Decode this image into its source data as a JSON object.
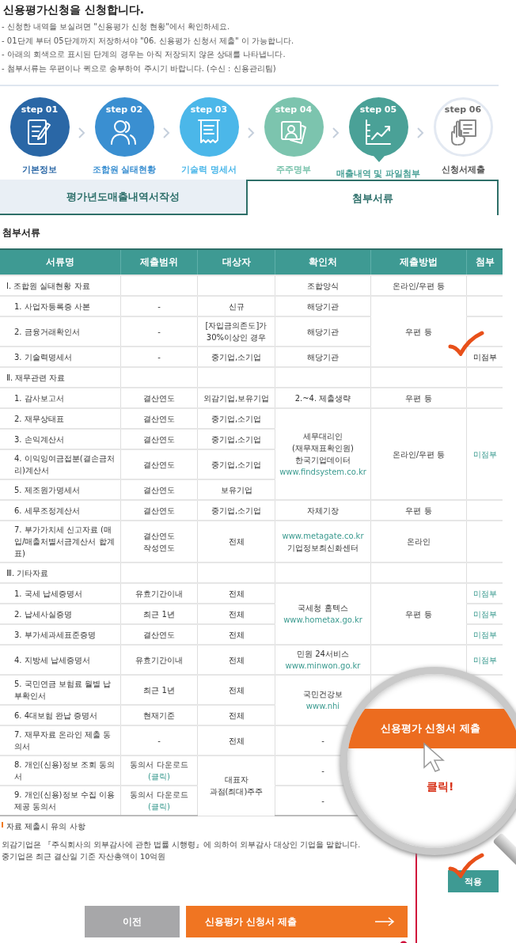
{
  "title": "신용평가신청을 신청합니다.",
  "notices": [
    "- 신청한 내역을 보실려면 \"신용평가 신청 현황\"에서 확인하세요.",
    "- 01단계 부터 05단계까지 저장하셔야 \"06. 신용평가 신청서 제출\" 이 가능합니다.",
    "- 아래의 회색으로 표시된 단계의 경우는 아직 저장되지 않은 상태를 나타냅니다.",
    "- 첨부서류는 우편이나 퀵으로 송부하여 주시기 바랍니다. (수신 : 신용관리팀)"
  ],
  "steps": [
    {
      "number": "step 01",
      "label": "기본정보",
      "color": "#2a67a6",
      "completed": true,
      "selected": false
    },
    {
      "number": "step 02",
      "label": "조합원 실태현황",
      "color": "#3a8fd1",
      "completed": true,
      "selected": false
    },
    {
      "number": "step 03",
      "label": "기술력 명세서",
      "color": "#4bb7e9",
      "completed": true,
      "selected": false
    },
    {
      "number": "step 04",
      "label": "주주명부",
      "color": "#7cc4ae",
      "completed": true,
      "selected": false
    },
    {
      "number": "step 05",
      "label": "매출내역 및 파일첨부",
      "color": "#4aa197",
      "completed": true,
      "selected": true
    },
    {
      "number": "step 06",
      "label": "신청서제출",
      "color": "#ffffff",
      "completed": false,
      "selected": false
    }
  ],
  "tabs": [
    {
      "label": "평가년도매출내역서작성",
      "selected": false
    },
    {
      "label": "첨부서류",
      "selected": true
    }
  ],
  "section_title": "첨부서류",
  "table": {
    "columns": [
      "서류명",
      "제출범위",
      "대상자",
      "확인처",
      "제출방법",
      "첨부"
    ],
    "rows": [
      {
        "kind": "section",
        "cells": [
          "Ⅰ. 조합원 실태현황 자료",
          null,
          null,
          "조합양식",
          "온라인/우편 등",
          null
        ]
      },
      {
        "kind": "item",
        "cells": [
          "1. 사업자등록증 사본",
          "-",
          "신규",
          "해당기관",
          {
            "lines": [
              "우편 등"
            ],
            "rowspan": 3
          },
          null
        ]
      },
      {
        "kind": "item",
        "cells": [
          "2. 금융거래확인서",
          "-",
          {
            "lines": [
              "[자입금의존도]가",
              "30%이상인 경우"
            ]
          },
          "해당기관",
          null
        ]
      },
      {
        "kind": "item",
        "cells": [
          "3. 기술력명세서",
          "-",
          "중기업,소기업",
          "해당기관",
          "미점부"
        ]
      },
      {
        "kind": "section",
        "cells": [
          "Ⅱ. 재무관련 자료",
          null,
          null,
          null,
          null,
          null
        ]
      },
      {
        "kind": "item",
        "cells": [
          "1. 감사보고서",
          "결산연도",
          "외감기업,보유기업",
          "2.~4. 제출생략",
          "우편 등",
          null
        ]
      },
      {
        "kind": "item",
        "cells": [
          "2. 재무상태표",
          "결산연도",
          "중기업,소기업",
          {
            "lines": [
              "세무대리인",
              "(재무재표확인원)",
              "한국기업데이터",
              {
                "text": "www.findsystem.co.kr",
                "kind": "link"
              }
            ],
            "rowspan": 4
          },
          {
            "lines": [
              "온라인/우편 등"
            ],
            "rowspan": 4
          },
          {
            "lines": [
              {
                "text": "미점부",
                "kind": "link"
              }
            ],
            "rowspan": 4
          }
        ]
      },
      {
        "kind": "item",
        "cells": [
          "3. 손익계산서",
          "결산연도",
          "중기업,소기업"
        ]
      },
      {
        "kind": "item",
        "cells": [
          "4. 이익잉여금접분(결손금처리)계산서",
          "결산연도",
          "중기업,소기업"
        ]
      },
      {
        "kind": "item",
        "cells": [
          "5. 제조원가명세서",
          "결산연도",
          "보유기업"
        ]
      },
      {
        "kind": "item",
        "cells": [
          "6. 세무조정계산서",
          "결산연도",
          "중기업,소기업",
          "자체기장",
          "우편 등",
          null
        ]
      },
      {
        "kind": "item",
        "cells": [
          "7. 부가가치세 신고자료 (매입/매출처별서금계산서 합계표)",
          {
            "lines": [
              "결산연도",
              "작성연도"
            ]
          },
          "전체",
          {
            "lines": [
              {
                "text": "www.metagate.co.kr",
                "kind": "link"
              },
              "기업정보최신화센터"
            ]
          },
          "온라인",
          null
        ]
      },
      {
        "kind": "section",
        "cells": [
          "Ⅲ. 기타자료",
          null,
          null,
          null,
          null,
          null
        ]
      },
      {
        "kind": "item",
        "cells": [
          "1. 국세 납세증명서",
          "유효기간이내",
          "전체",
          {
            "lines": [
              "국세청 홈텍스",
              {
                "text": "www.hometax.go.kr",
                "kind": "link"
              }
            ],
            "rowspan": 3
          },
          {
            "lines": [
              "우편 등"
            ],
            "rowspan": 3
          },
          {
            "lines": [
              {
                "text": "미점부",
                "kind": "link"
              }
            ]
          }
        ]
      },
      {
        "kind": "item",
        "cells": [
          "2. 납세사실증명",
          "최근 1년",
          "전체",
          {
            "lines": [
              {
                "text": "미점부",
                "kind": "link"
              }
            ]
          }
        ]
      },
      {
        "kind": "item",
        "cells": [
          "3. 부가세과세표준증명",
          "결산연도",
          "전체",
          {
            "lines": [
              {
                "text": "미점부",
                "kind": "link"
              }
            ]
          }
        ]
      },
      {
        "kind": "item",
        "cells": [
          "4. 지방세 납세증명서",
          "유효기간이내",
          "전체",
          {
            "lines": [
              "민원 24서비스",
              {
                "text": "www.minwon.go.kr",
                "kind": "link"
              }
            ]
          },
          null,
          {
            "lines": [
              {
                "text": "미점부",
                "kind": "link"
              }
            ]
          }
        ]
      },
      {
        "kind": "item",
        "cells": [
          "5. 국민연금 보험료 월별 납부확인서",
          "최근 1년",
          "전체",
          {
            "lines": [
              "국민건강보",
              {
                "text": "www.nhi",
                "kind": "link"
              }
            ],
            "rowspan": 2
          },
          null,
          null
        ]
      },
      {
        "kind": "item",
        "cells": [
          "6. 4대보험 완납 증명서",
          "현재기준",
          "전체",
          null,
          null
        ]
      },
      {
        "kind": "item",
        "cells": [
          "7. 재무자료 온라인 제출 동의서",
          "-",
          "전체",
          "-",
          null,
          null
        ]
      },
      {
        "kind": "item",
        "cells": [
          "8. 개인(신용)정보 조회 동의서",
          {
            "lines": [
              "동의서 다운로드",
              {
                "text": "(클릭)",
                "kind": "link"
              }
            ]
          },
          {
            "lines": [
              "대표자",
              "과점(최대)주주"
            ],
            "rowspan": 2
          },
          "-",
          null,
          null
        ]
      },
      {
        "kind": "item",
        "cells": [
          "9. 개인(신용)정보 수집 이용 제공 동의서",
          {
            "lines": [
              "동의서 다운로드",
              {
                "text": "(클릭)",
                "kind": "link"
              }
            ]
          },
          "-",
          null,
          null
        ]
      }
    ]
  },
  "notes_title": "자료 제출시 유의 사항",
  "notes": [
    "외감기업은 『주식회사의 외부감사에 관한 법률 시행령』에 의하여 외부감사 대상인 기업을 말합니다.",
    "중기업은 최근 결산일 기준 자산총액이 10억원"
  ],
  "apply_button": "적용",
  "buttons": [
    {
      "label": "이전",
      "kind": "secondary"
    },
    {
      "label": "신용평가 신청서 제출",
      "kind": "primary"
    }
  ],
  "magnifier": {
    "button": "신용평가 신청서 제출",
    "caption": "클릭!"
  }
}
